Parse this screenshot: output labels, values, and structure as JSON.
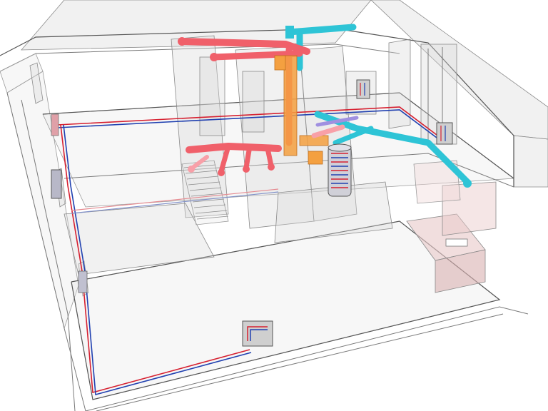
{
  "colors": {
    "background": "#ffffff",
    "wireframe": "#7a7a7a",
    "supply_duct": "#f0606a",
    "exhaust_duct": "#2ec4d6",
    "heat_recovery_unit": "#f4a040",
    "pipe_hot": "#d62030",
    "pipe_cold": "#2040b0",
    "kitchen_cabinet": "#e8c8c8"
  },
  "icons": {
    "radiator": "radiator-icon",
    "water_tank": "water-tank-icon",
    "ventilation_unit": "ventilation-unit-icon"
  }
}
